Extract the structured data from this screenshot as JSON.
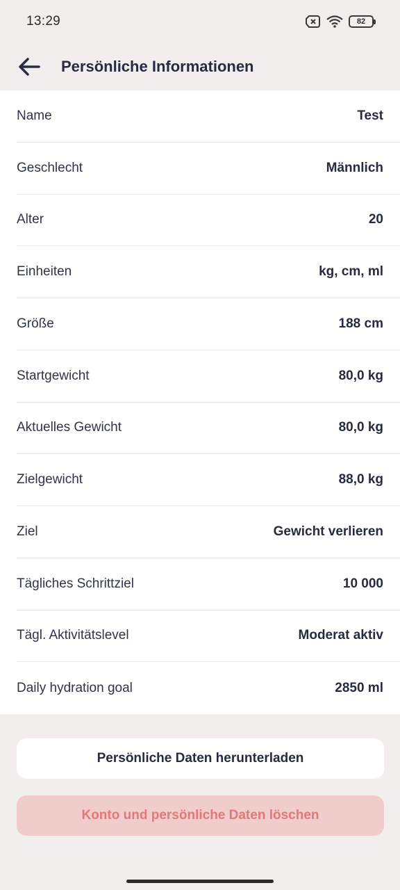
{
  "status_bar": {
    "time": "13:29",
    "battery": "82",
    "icons": [
      "no-sim-icon",
      "wifi-icon",
      "battery-icon"
    ]
  },
  "app_bar": {
    "back_icon": "arrow-left-icon",
    "title": "Persönliche Informationen"
  },
  "rows": [
    {
      "label": "Name",
      "value": "Test"
    },
    {
      "label": "Geschlecht",
      "value": "Männlich"
    },
    {
      "label": "Alter",
      "value": "20"
    },
    {
      "label": "Einheiten",
      "value": "kg, cm, ml"
    },
    {
      "label": "Größe",
      "value": "188 cm"
    },
    {
      "label": "Startgewicht",
      "value": "80,0 kg"
    },
    {
      "label": "Aktuelles Gewicht",
      "value": "80,0 kg"
    },
    {
      "label": "Zielgewicht",
      "value": "88,0 kg"
    },
    {
      "label": "Ziel",
      "value": "Gewicht verlieren"
    },
    {
      "label": "Tägliches Schrittziel",
      "value": "10 000"
    },
    {
      "label": "Tägl. Aktivitätslevel",
      "value": "Moderat aktiv"
    },
    {
      "label": "Daily hydration goal",
      "value": "2850 ml"
    }
  ],
  "buttons": {
    "download_label": "Persönliche Daten herunterladen",
    "delete_label": "Konto und persönliche Daten löschen"
  },
  "colors": {
    "background": "#f2eeee",
    "text_dark": "#262b40",
    "delete_bg": "#f0cccb",
    "delete_text": "#e07a78"
  }
}
